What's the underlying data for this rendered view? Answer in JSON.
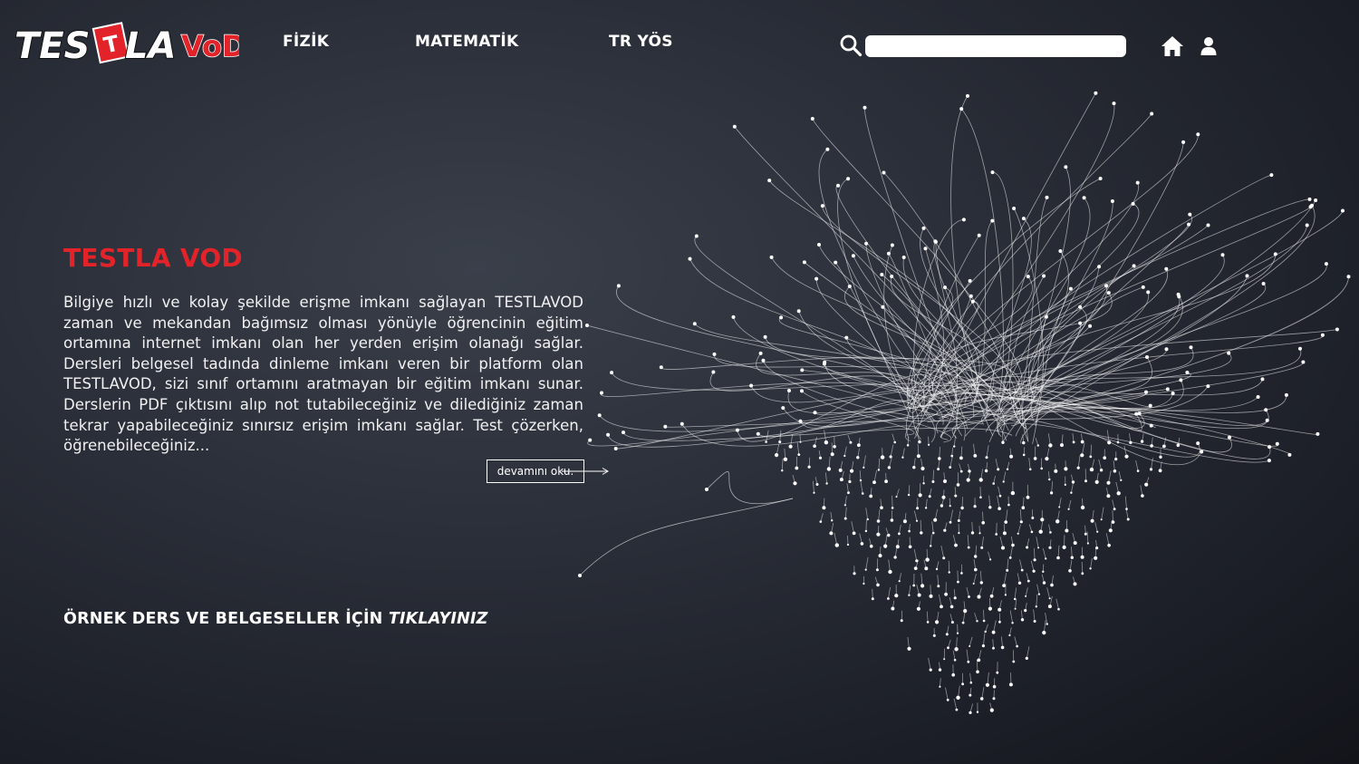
{
  "brand": {
    "logo_text": "TESTLAVOD",
    "logo_letters": [
      "TES",
      "T",
      "LA",
      "VoD"
    ],
    "colors": {
      "accent": "#e3232a",
      "text": "#ffffff",
      "background": "#2a2e38"
    }
  },
  "nav": {
    "items": [
      {
        "label": "FİZİK"
      },
      {
        "label": "MATEMATİK"
      },
      {
        "label": "TR YÖS"
      }
    ]
  },
  "search": {
    "value": "",
    "placeholder": "",
    "icon": "search-icon"
  },
  "header_icons": {
    "home": "home-icon",
    "user": "user-icon"
  },
  "hero": {
    "title": "TESTLA VOD",
    "description": "Bilgiye hızlı ve kolay şekilde erişme imkanı sağlayan TESTLAVOD zaman ve mekandan bağımsız olması yönüyle öğrencinin eğitim ortamına internet imkanı olan her yerden erişim olanağı sağlar. Dersleri belgesel tadında dinleme imkanı veren bir platform olan TESTLAVOD, sizi sınıf ortamını aratmayan bir eğitim imkanı sunar. Derslerin PDF çıktısını alıp not tutabileceğiniz ve dilediğiniz zaman tekrar yapabileceğiniz sınırsız erişim imkanı sağlar. Test çözerken, öğrenebileceğiniz...",
    "read_more": "devamını oku."
  },
  "cta": {
    "text": "ÖRNEK DERS VE BELGESELLER İÇİN ",
    "link": "TIKLAYINIZ"
  }
}
